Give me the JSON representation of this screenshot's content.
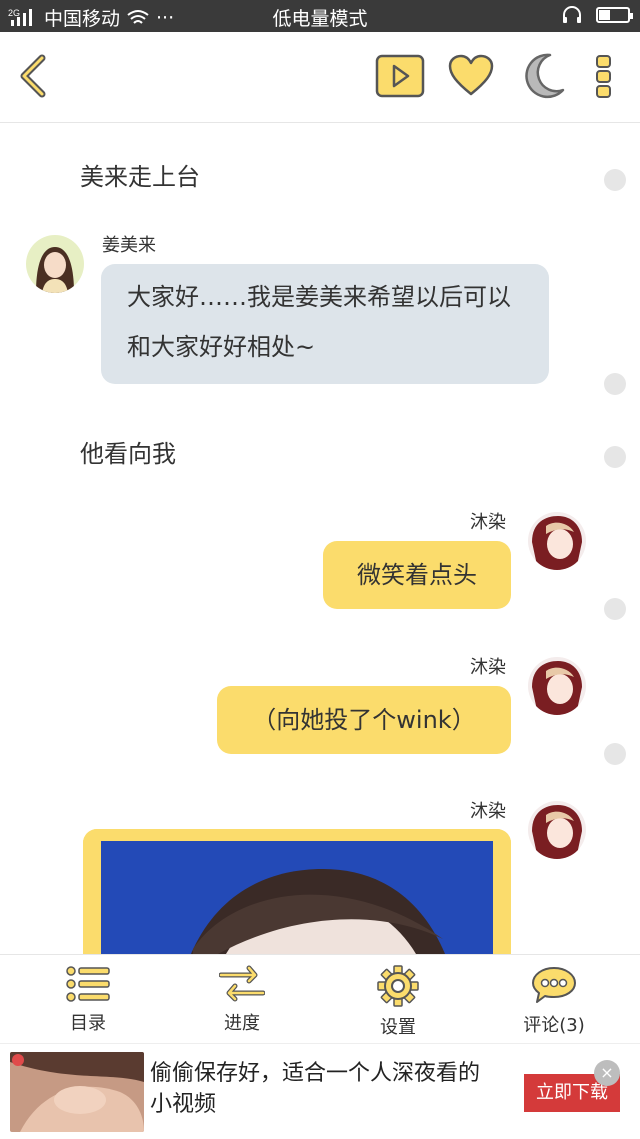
{
  "status_bar": {
    "network_badge": "2G",
    "carrier": "中国移动",
    "more": "···",
    "mode": "低电量模式",
    "battery_level": 0.35
  },
  "toolbar": {
    "icons": [
      "back-icon",
      "play-icon",
      "heart-icon",
      "moon-icon",
      "more-icon"
    ],
    "accent": "#fbdc6c"
  },
  "chat": {
    "narration_1": "美来走上台",
    "char1_name": "姜美来",
    "char1_message": "大家好……我是姜美来希望以后可以和大家好好相处~",
    "narration_2": "他看向我",
    "char2_name": "沐染",
    "char2_message_1": "微笑着点头",
    "char2_message_2": "（向她投了个wink）"
  },
  "bottom_nav": {
    "catalog": "目录",
    "progress": "进度",
    "settings": "设置",
    "comments": "评论(3)"
  },
  "ad": {
    "text": "偷偷保存好，适合一个人深夜看的小视频",
    "button": "立即下载",
    "close": "×"
  },
  "colors": {
    "bubble_left": "#dde4ea",
    "bubble_right": "#fbdc6c",
    "ad_button": "#d43a3a"
  }
}
